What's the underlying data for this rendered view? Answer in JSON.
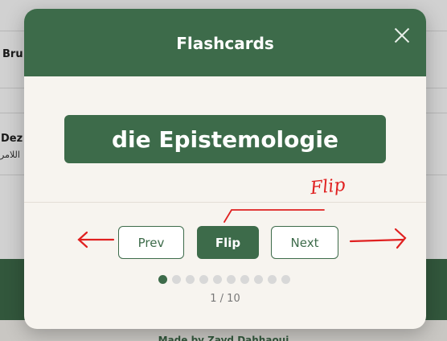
{
  "background": {
    "card1_text": "Bru",
    "card2_text": "Dez",
    "card2_arabic": "اللامر",
    "footer_text": "Made by Zayd Dahhaoui"
  },
  "modal": {
    "title": "Flashcards",
    "close_icon": "close-icon",
    "card_text": "die Epistemologie",
    "buttons": {
      "prev": "Prev",
      "flip": "Flip",
      "next": "Next"
    },
    "dots": {
      "total": 10,
      "active_index": 0
    },
    "counter": "1 / 10"
  },
  "annotations": {
    "flip_note": "Flip",
    "left_arrow": "arrow-left",
    "right_arrow": "arrow-right",
    "color": "#e02020"
  },
  "colors": {
    "brand_green": "#3d6b4a",
    "modal_bg": "#f7f4ef",
    "dot_inactive": "#d8d8d8"
  }
}
